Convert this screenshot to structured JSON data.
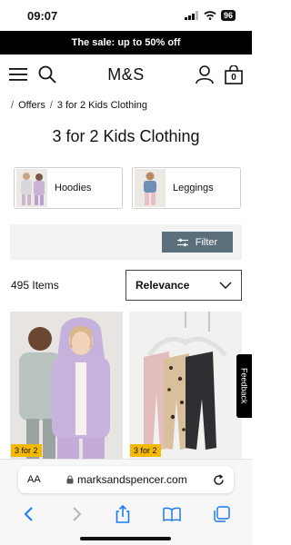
{
  "status_bar": {
    "time": "09:07",
    "battery": "96"
  },
  "promo": {
    "text": "The sale: up to 50% off"
  },
  "header": {
    "logo": "M&S",
    "basket_count": "0"
  },
  "breadcrumb": [
    "Offers",
    "3 for 2 Kids Clothing"
  ],
  "page_title": "3 for 2 Kids Clothing",
  "categories": [
    {
      "label": "Hoodies"
    },
    {
      "label": "Leggings"
    }
  ],
  "filter": {
    "label": "Filter"
  },
  "results": {
    "count": "495 Items"
  },
  "sort": {
    "selected": "Relevance"
  },
  "products": [
    {
      "badge": "3 for 2"
    },
    {
      "badge": "3 for 2"
    }
  ],
  "feedback": {
    "label": "Feedback"
  },
  "browser": {
    "text_size": "AA",
    "url": "marksandspencer.com"
  },
  "colors": {
    "filter_button": "#5b6e7c",
    "badge": "#f5b800",
    "browser_accent": "#1a7cf5"
  }
}
